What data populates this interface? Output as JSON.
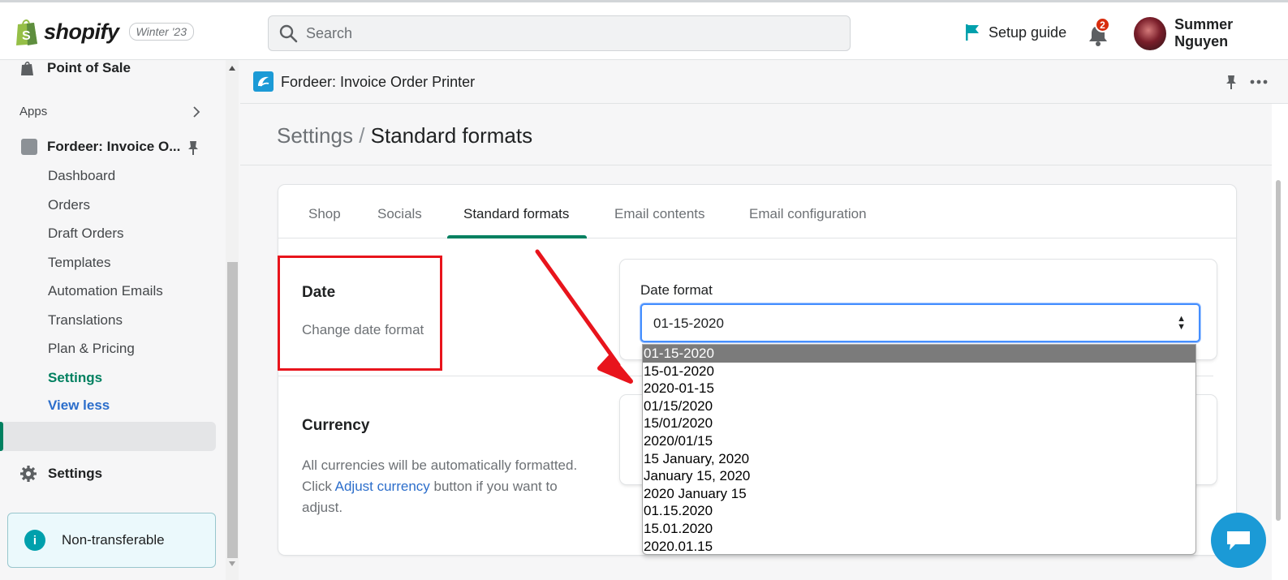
{
  "topbar": {
    "brand": "shopify",
    "edition": "Winter '23",
    "search_placeholder": "Search",
    "setup_guide": "Setup guide",
    "notifications_count": "2",
    "user_name": "Summer Nguyen"
  },
  "sidebar": {
    "point_of_sale": "Point of Sale",
    "apps": "Apps",
    "app_name": "Fordeer: Invoice O...",
    "sub_items": [
      "Dashboard",
      "Orders",
      "Draft Orders",
      "Templates",
      "Automation Emails",
      "Translations",
      "Plan & Pricing",
      "Settings"
    ],
    "view_less": "View less",
    "settings": "Settings",
    "non_transferable": "Non-transferable"
  },
  "appbar": {
    "title": "Fordeer: Invoice Order Printer"
  },
  "page": {
    "breadcrumb_parent": "Settings",
    "breadcrumb_sep": "/",
    "breadcrumb_current": "Standard formats"
  },
  "tabs": [
    "Shop",
    "Socials",
    "Standard formats",
    "Email contents",
    "Email configuration"
  ],
  "date_section": {
    "title": "Date",
    "description": "Change date format",
    "field_label": "Date format",
    "selected": "01-15-2020",
    "options": [
      "01-15-2020",
      "15-01-2020",
      "2020-01-15",
      "01/15/2020",
      "15/01/2020",
      "2020/01/15",
      "15 January, 2020",
      "January 15, 2020",
      "2020 January 15",
      "01.15.2020",
      "15.01.2020",
      "2020.01.15"
    ]
  },
  "currency_section": {
    "title": "Currency",
    "desc_before": "All currencies will be automatically formatted. Click ",
    "link": "Adjust currency",
    "desc_after": " button if you want to adjust."
  },
  "colors": {
    "accent_green": "#008060",
    "annotation_red": "#e8141c",
    "link_blue": "#2c6ecb",
    "app_blue": "#1b9ad6"
  }
}
